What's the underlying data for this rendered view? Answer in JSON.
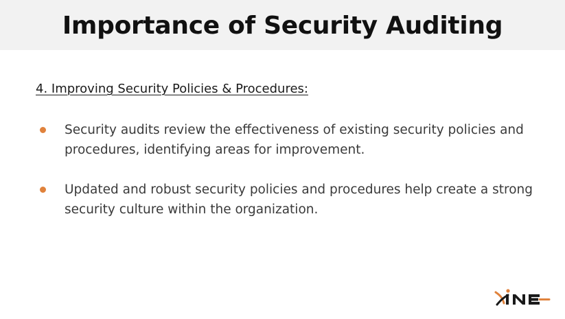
{
  "header": {
    "title": "Importance of Security Auditing"
  },
  "section": {
    "heading": "4. Improving Security Policies & Procedures:",
    "bullets": [
      {
        "text": "Security audits review the effectiveness of existing security policies and procedures, identifying areas for improvement."
      },
      {
        "text": "Updated and robust security policies and procedures help create a strong security culture within the organization."
      }
    ]
  },
  "logo": {
    "brand": "INE",
    "icon": "ine-logo-icon"
  },
  "colors": {
    "header_bg": "#f2f2f2",
    "bullet_accent": "#e0823c",
    "logo_accent": "#e0823c",
    "logo_dark": "#1a1a1a"
  }
}
